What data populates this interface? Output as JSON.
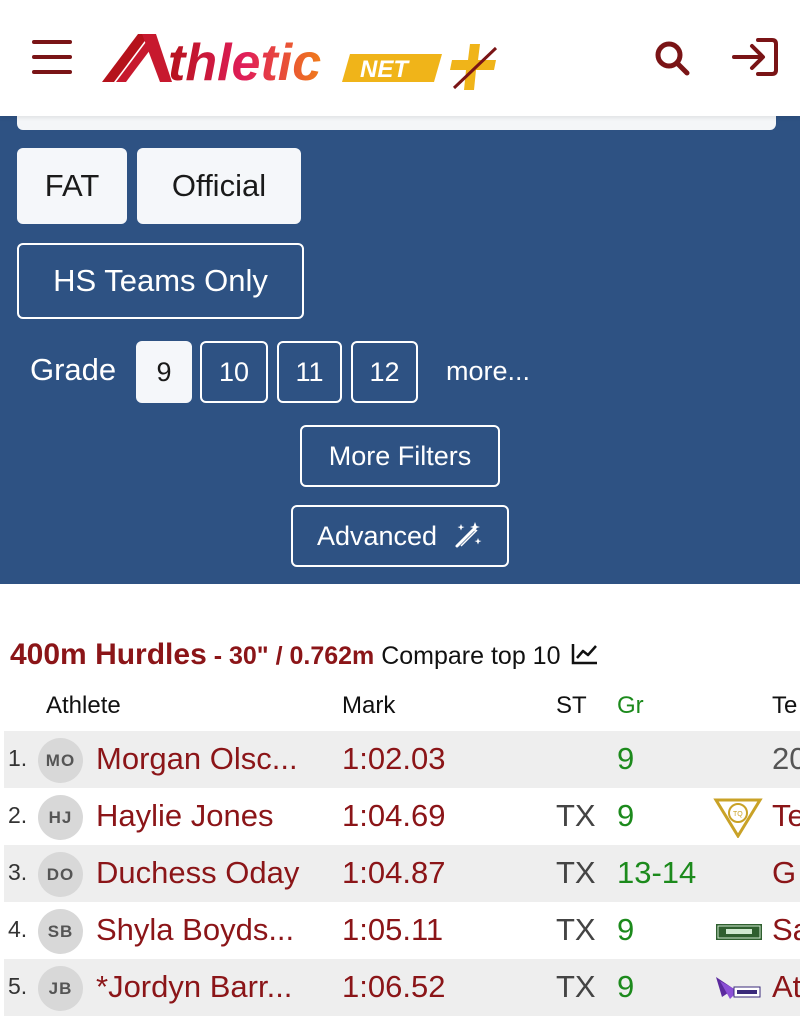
{
  "header": {
    "logo_text": "thletic",
    "logo_badge": "NET"
  },
  "filters": {
    "timing_options": [
      "FAT",
      "Official"
    ],
    "hs_teams_label": "HS Teams Only",
    "grade_label": "Grade",
    "grades": [
      "9",
      "10",
      "11",
      "12"
    ],
    "selected_grade": "9",
    "more_label": "more...",
    "more_filters_label": "More Filters",
    "advanced_label": "Advanced"
  },
  "event": {
    "name": "400m Hurdles",
    "spec": " - 30\" / 0.762m ",
    "compare_label": "Compare top 10"
  },
  "table": {
    "headers": {
      "athlete": "Athlete",
      "mark": "Mark",
      "st": "ST",
      "gr": "Gr",
      "team": "Te"
    },
    "rows": [
      {
        "rank": "1.",
        "initials": "MO",
        "athlete": "Morgan Olsc...",
        "mark": "1:02.03",
        "st": "",
        "gr": "9",
        "team": "20",
        "team_logo": "none"
      },
      {
        "rank": "2.",
        "initials": "HJ",
        "athlete": "Haylie Jones",
        "mark": "1:04.69",
        "st": "TX",
        "gr": "9",
        "team": "Te",
        "team_logo": "triangle-crest"
      },
      {
        "rank": "3.",
        "initials": "DO",
        "athlete": "Duchess Oday",
        "mark": "1:04.87",
        "st": "TX",
        "gr": "13-14",
        "team": "G",
        "team_logo": "none"
      },
      {
        "rank": "4.",
        "initials": "SB",
        "athlete": "Shyla Boyds...",
        "mark": "1:05.11",
        "st": "TX",
        "gr": "9",
        "team": "Sa",
        "team_logo": "swift-badge"
      },
      {
        "rank": "5.",
        "initials": "JB",
        "athlete": "*Jordyn Barr...",
        "mark": "1:06.52",
        "st": "TX",
        "gr": "9",
        "team": "At",
        "team_logo": "wing-badge"
      }
    ]
  },
  "colors": {
    "brand_red": "#8b1518",
    "panel_blue": "#2e5283",
    "grade_green": "#1c8a1c",
    "logo_yellow": "#f0b419"
  }
}
